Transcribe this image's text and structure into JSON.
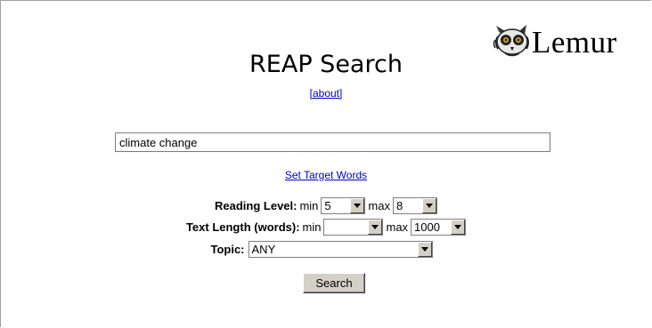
{
  "logo": {
    "text": "Lemur",
    "icon": "lemur-face-icon"
  },
  "page": {
    "title": "REAP Search"
  },
  "links": {
    "about": "[about]",
    "set_target_words": "Set Target Words"
  },
  "search": {
    "query_value": "climate change"
  },
  "filters": {
    "reading_level": {
      "label": "Reading Level:",
      "min_label": "min",
      "min_value": "5",
      "max_label": "max",
      "max_value": "8"
    },
    "text_length": {
      "label": "Text Length (words):",
      "min_label": "min",
      "min_value": "",
      "max_label": "max",
      "max_value": "1000"
    },
    "topic": {
      "label": "Topic:",
      "value": "ANY"
    }
  },
  "actions": {
    "search_label": "Search"
  },
  "colors": {
    "link": "#0000cc",
    "button_face": "#d4d0c8"
  }
}
